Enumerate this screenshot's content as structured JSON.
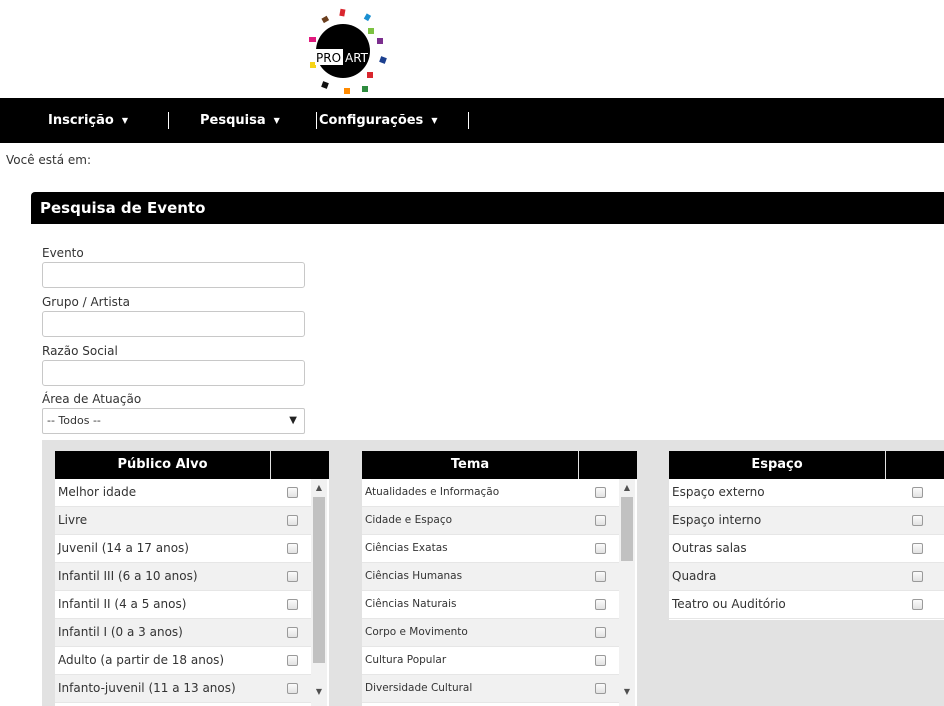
{
  "logo": {
    "text_left": "PRO",
    "text_right": "ART"
  },
  "nav": {
    "items": [
      {
        "label": "Inscrição",
        "caret": "▼"
      },
      {
        "label": "Pesquisa",
        "caret": "▼"
      },
      {
        "label": "Configurações",
        "caret": "▼"
      }
    ]
  },
  "breadcrumb": "Você está em:",
  "form": {
    "title": "Pesquisa de Evento",
    "evento_label": "Evento",
    "evento_value": "",
    "grupo_label": "Grupo / Artista",
    "grupo_value": "",
    "razao_label": "Razão Social",
    "razao_value": "",
    "area_label": "Área de Atuação",
    "area_selected": "-- Todos --",
    "select_arrow": "▼"
  },
  "publico": {
    "title": "Público Alvo",
    "items": [
      "Melhor idade",
      "Livre",
      "Juvenil (14 a 17 anos)",
      "Infantil III (6 a 10 anos)",
      "Infantil II (4 a 5 anos)",
      "Infantil I (0 a 3 anos)",
      "Adulto (a partir de 18 anos)",
      "Infanto-juvenil (11 a 13 anos)"
    ]
  },
  "tema": {
    "title": "Tema",
    "items": [
      "Atualidades e Informação",
      "Cidade e Espaço",
      "Ciências Exatas",
      "Ciências Humanas",
      "Ciências Naturais",
      "Corpo e Movimento",
      "Cultura Popular",
      "Diversidade Cultural"
    ]
  },
  "espaco": {
    "title": "Espaço",
    "items": [
      "Espaço externo",
      "Espaço interno",
      "Outras salas",
      "Quadra",
      "Teatro ou Auditório"
    ]
  },
  "scroll": {
    "up": "▲",
    "down": "▼"
  }
}
